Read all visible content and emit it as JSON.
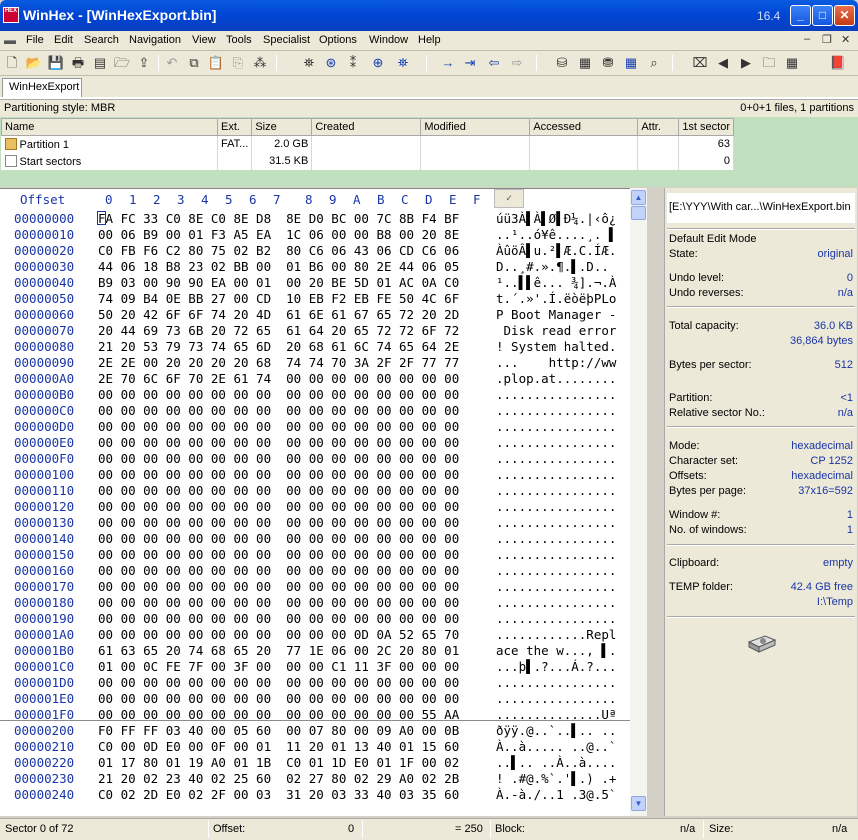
{
  "window": {
    "title": "WinHex - [WinHexExport.bin]",
    "version": "16.4",
    "logo_text": "HEX"
  },
  "menu": [
    "File",
    "Edit",
    "Search",
    "Navigation",
    "View",
    "Tools",
    "Specialist",
    "Options",
    "Window",
    "Help"
  ],
  "tab": {
    "label": "WinHexExport"
  },
  "info": {
    "partition_style": "Partitioning style: MBR",
    "file_count": "0+0+1 files, 1 partitions"
  },
  "dir": {
    "columns": [
      "Name",
      "Ext.",
      "Size",
      "Created",
      "Modified",
      "Accessed",
      "Attr.",
      "1st sector"
    ],
    "rows": [
      {
        "name": "Partition 1",
        "ext": "FAT...",
        "size": "2.0 GB",
        "created": "",
        "modified": "",
        "accessed": "",
        "attr": "",
        "first_sector": "63"
      },
      {
        "name": "Start sectors",
        "ext": "",
        "size": "31.5 KB",
        "created": "",
        "modified": "",
        "accessed": "",
        "attr": "",
        "first_sector": "0"
      }
    ]
  },
  "hex": {
    "header_offset": "Offset",
    "header_cols": [
      "0",
      "1",
      "2",
      "3",
      "4",
      "5",
      "6",
      "7",
      "8",
      "9",
      "A",
      "B",
      "C",
      "D",
      "E",
      "F"
    ],
    "sort_mark": "✓",
    "rows": [
      {
        "o": "00000000",
        "h": "FA FC 33 C0 8E C0 8E D8  8E D0 BC 00 7C 8B F4 BF",
        "a": "úü3À▌À▌Ø▌Ð¼.|‹ô¿"
      },
      {
        "o": "00000010",
        "h": "00 06 B9 00 01 F3 A5 EA  1C 06 00 00 B8 00 20 8E",
        "a": "..¹..ó¥ê....¸. ▌"
      },
      {
        "o": "00000020",
        "h": "C0 FB F6 C2 80 75 02 B2  80 C6 06 43 06 CD C6 06",
        "a": "ÀûöÂ▌u.²▌Æ.C.ÍÆ."
      },
      {
        "o": "00000030",
        "h": "44 06 18 B8 23 02 BB 00  01 B6 00 80 2E 44 06 05",
        "a": "D..¸#.».¶.▌.D.."
      },
      {
        "o": "00000040",
        "h": "B9 03 00 90 90 EA 00 01  00 20 BE 5D 01 AC 0A C0",
        "a": "¹..▌▌ê... ¾].¬.À"
      },
      {
        "o": "00000050",
        "h": "74 09 B4 0E BB 27 00 CD  10 EB F2 EB FE 50 4C 6F",
        "a": "t.´.»'.Í.ëòëþPLo"
      },
      {
        "o": "00000060",
        "h": "50 20 42 6F 6F 74 20 4D  61 6E 61 67 65 72 20 2D",
        "a": "P Boot Manager -"
      },
      {
        "o": "00000070",
        "h": "20 44 69 73 6B 20 72 65  61 64 20 65 72 72 6F 72",
        "a": " Disk read error"
      },
      {
        "o": "00000080",
        "h": "21 20 53 79 73 74 65 6D  20 68 61 6C 74 65 64 2E",
        "a": "! System halted."
      },
      {
        "o": "00000090",
        "h": "2E 2E 00 20 20 20 20 68  74 74 70 3A 2F 2F 77 77",
        "a": "...    http://ww"
      },
      {
        "o": "000000A0",
        "h": "2E 70 6C 6F 70 2E 61 74  00 00 00 00 00 00 00 00",
        "a": ".plop.at........"
      },
      {
        "o": "000000B0",
        "h": "00 00 00 00 00 00 00 00  00 00 00 00 00 00 00 00",
        "a": "................"
      },
      {
        "o": "000000C0",
        "h": "00 00 00 00 00 00 00 00  00 00 00 00 00 00 00 00",
        "a": "................"
      },
      {
        "o": "000000D0",
        "h": "00 00 00 00 00 00 00 00  00 00 00 00 00 00 00 00",
        "a": "................"
      },
      {
        "o": "000000E0",
        "h": "00 00 00 00 00 00 00 00  00 00 00 00 00 00 00 00",
        "a": "................"
      },
      {
        "o": "000000F0",
        "h": "00 00 00 00 00 00 00 00  00 00 00 00 00 00 00 00",
        "a": "................"
      },
      {
        "o": "00000100",
        "h": "00 00 00 00 00 00 00 00  00 00 00 00 00 00 00 00",
        "a": "................"
      },
      {
        "o": "00000110",
        "h": "00 00 00 00 00 00 00 00  00 00 00 00 00 00 00 00",
        "a": "................"
      },
      {
        "o": "00000120",
        "h": "00 00 00 00 00 00 00 00  00 00 00 00 00 00 00 00",
        "a": "................"
      },
      {
        "o": "00000130",
        "h": "00 00 00 00 00 00 00 00  00 00 00 00 00 00 00 00",
        "a": "................"
      },
      {
        "o": "00000140",
        "h": "00 00 00 00 00 00 00 00  00 00 00 00 00 00 00 00",
        "a": "................"
      },
      {
        "o": "00000150",
        "h": "00 00 00 00 00 00 00 00  00 00 00 00 00 00 00 00",
        "a": "................"
      },
      {
        "o": "00000160",
        "h": "00 00 00 00 00 00 00 00  00 00 00 00 00 00 00 00",
        "a": "................"
      },
      {
        "o": "00000170",
        "h": "00 00 00 00 00 00 00 00  00 00 00 00 00 00 00 00",
        "a": "................"
      },
      {
        "o": "00000180",
        "h": "00 00 00 00 00 00 00 00  00 00 00 00 00 00 00 00",
        "a": "................"
      },
      {
        "o": "00000190",
        "h": "00 00 00 00 00 00 00 00  00 00 00 00 00 00 00 00",
        "a": "................"
      },
      {
        "o": "000001A0",
        "h": "00 00 00 00 00 00 00 00  00 00 00 0D 0A 52 65 70",
        "a": "............Repl"
      },
      {
        "o": "000001B0",
        "h": "61 63 65 20 74 68 65 20  77 1E 06 00 2C 20 80 01",
        "a": "ace the w..., ▌."
      },
      {
        "o": "000001C0",
        "h": "01 00 0C FE 7F 00 3F 00  00 00 C1 11 3F 00 00 00",
        "a": "...þ▌.?...Á.?..."
      },
      {
        "o": "000001D0",
        "h": "00 00 00 00 00 00 00 00  00 00 00 00 00 00 00 00",
        "a": "................"
      },
      {
        "o": "000001E0",
        "h": "00 00 00 00 00 00 00 00  00 00 00 00 00 00 00 00",
        "a": "................"
      },
      {
        "o": "000001F0",
        "h": "00 00 00 00 00 00 00 00  00 00 00 00 00 00 55 AA",
        "a": "..............Uª"
      },
      {
        "o": "00000200",
        "h": "F0 FF FF 03 40 00 05 60  00 07 80 00 09 A0 00 0B",
        "a": "ðÿÿ.@..`..▌.. .."
      },
      {
        "o": "00000210",
        "h": "C0 00 0D E0 00 0F 00 01  11 20 01 13 40 01 15 60",
        "a": "À..à..... ..@..`"
      },
      {
        "o": "00000220",
        "h": "01 17 80 01 19 A0 01 1B  C0 01 1D E0 01 1F 00 02",
        "a": "..▌.. ..À..à...."
      },
      {
        "o": "00000230",
        "h": "21 20 02 23 40 02 25 60  02 27 80 02 29 A0 02 2B",
        "a": "! .#@.%`.'▌.) .+"
      },
      {
        "o": "00000240",
        "h": "C0 02 2D E0 02 2F 00 03  31 20 03 33 40 03 35 60",
        "a": "À.-à./..1 .3@.5`"
      }
    ]
  },
  "panel": {
    "path": "[E:\\YYY\\With car...\\WinHexExport.bin",
    "edit_mode": "Default Edit Mode",
    "state_label": "State:",
    "state": "original",
    "undo_level_label": "Undo level:",
    "undo_level": "0",
    "undo_reverses_label": "Undo reverses:",
    "undo_reverses": "n/a",
    "total_capacity_label": "Total capacity:",
    "total_capacity_kb": "36.0 KB",
    "total_capacity_bytes": "36,864 bytes",
    "bytes_per_sector_label": "Bytes per sector:",
    "bytes_per_sector": "512",
    "partition_label": "Partition:",
    "partition": "<1",
    "rel_sector_label": "Relative sector No.:",
    "rel_sector": "n/a",
    "mode_label": "Mode:",
    "mode": "hexadecimal",
    "charset_label": "Character set:",
    "charset": "CP 1252",
    "offsets_label": "Offsets:",
    "offsets": "hexadecimal",
    "bpp_label": "Bytes per page:",
    "bpp": "37x16=592",
    "window_no_label": "Window #:",
    "window_no": "1",
    "windows_label": "No. of windows:",
    "windows": "1",
    "clipboard_label": "Clipboard:",
    "clipboard": "empty",
    "temp_label": "TEMP folder:",
    "temp_free": "42.4 GB free",
    "temp_path": "I:\\Temp"
  },
  "status": {
    "sector": "Sector 0 of 72",
    "offset_label": "Offset:",
    "offset": "0",
    "value": "= 250",
    "block_label": "Block:",
    "block": "n/a",
    "size_label": "Size:",
    "size": "n/a"
  }
}
